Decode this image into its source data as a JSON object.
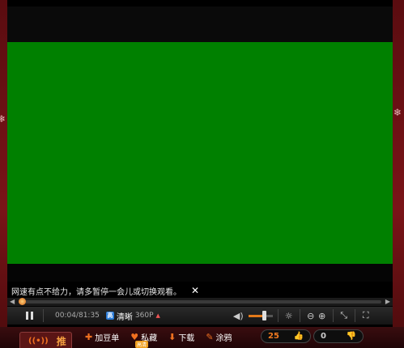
{
  "notice": {
    "message": "网速有点不给力，请多暂停一会儿或切换观看。",
    "close_symbol": "✕"
  },
  "progress": {
    "played_fraction": 0.01
  },
  "controls": {
    "time_text": "00:04/81:35",
    "quality_label": "清晰",
    "quality_resolution": "360P",
    "volume_fraction": 0.65
  },
  "bottom": {
    "promo_label": "推",
    "actions": [
      {
        "icon": "plus-icon",
        "label": "加豆单"
      },
      {
        "icon": "heart-icon",
        "label": "私藏"
      },
      {
        "icon": "download-icon",
        "label": "下载"
      },
      {
        "icon": "doodle-icon",
        "label": "涂鸦"
      }
    ],
    "badge_text": "高清",
    "likes": "25",
    "dislikes": "0"
  },
  "colors": {
    "video_placeholder": "#008000",
    "accent": "#e47a1a",
    "frame": "#7a1418"
  }
}
